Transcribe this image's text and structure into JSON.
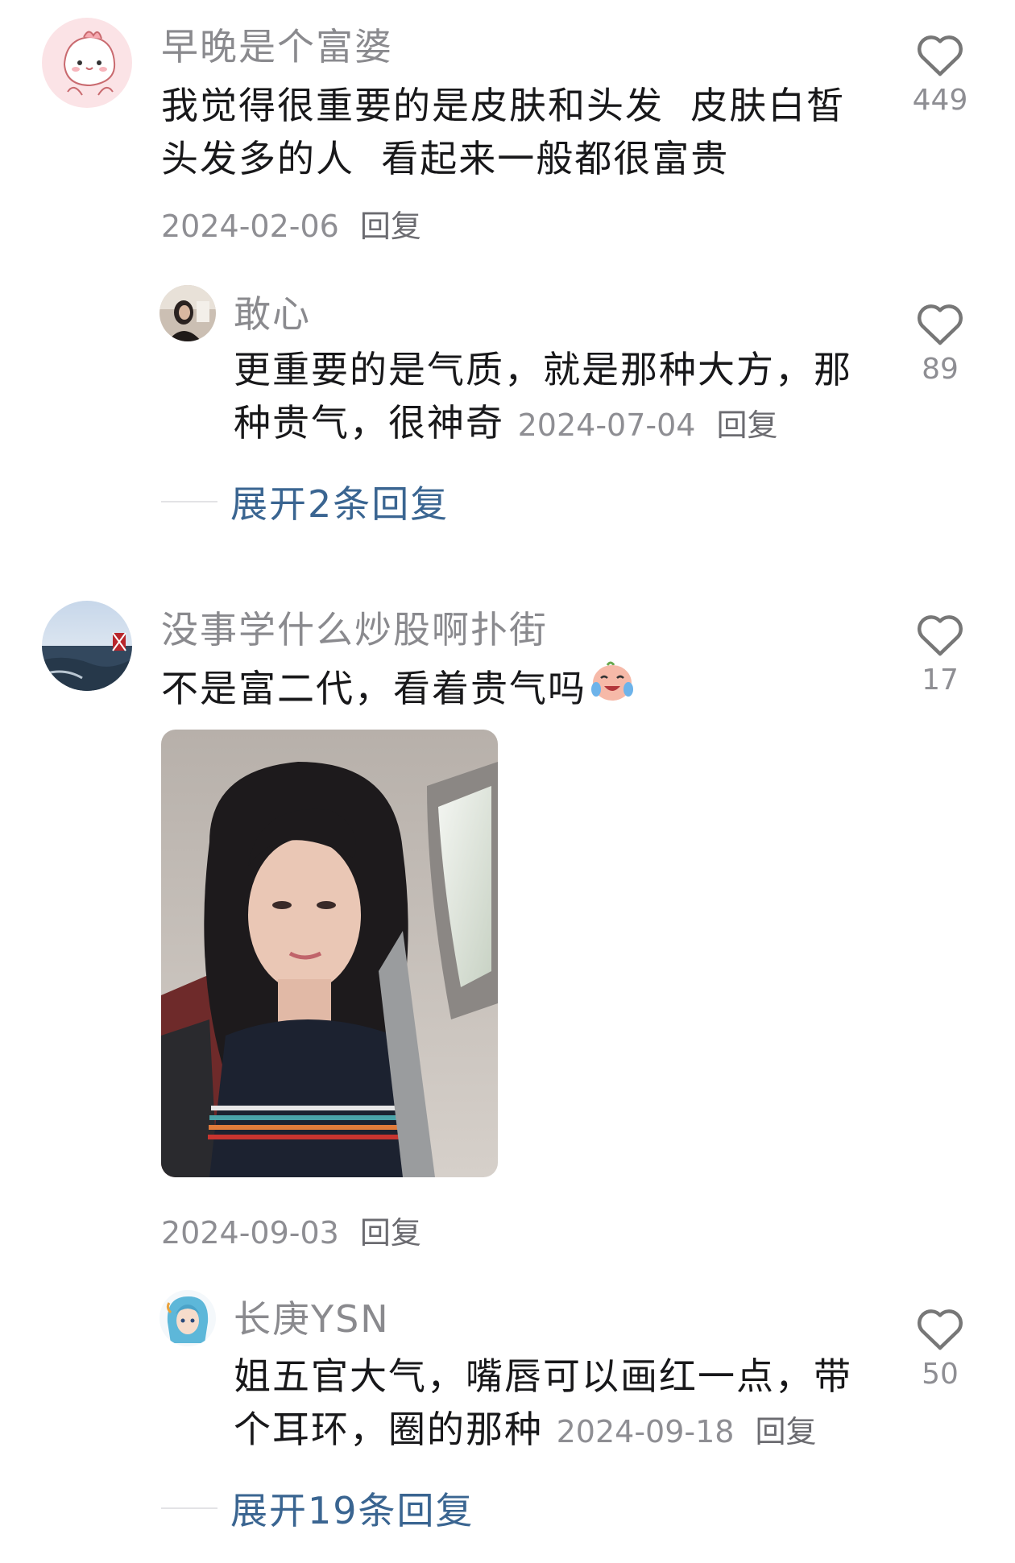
{
  "comments": [
    {
      "username": "早晚是个富婆",
      "text_line1": "我觉得很重要的是皮肤和头发  皮肤白皙",
      "text_line2": "头发多的人  看起来一般都很富贵",
      "date": "2024-02-06",
      "reply_label": "回复",
      "likes": "449",
      "avatar_icon": "pink-cartoon-avatar-icon",
      "replies": [
        {
          "username": "敢心",
          "text_line1": "更重要的是气质，就是那种大方，那",
          "text_line2": "种贵气，很神奇",
          "date": "2024-07-04",
          "reply_label": "回复",
          "likes": "89"
        }
      ],
      "expand_label": "展开2条回复"
    },
    {
      "username": "没事学什么炒股啊扑街",
      "text": "不是富二代，看着贵气吗",
      "emoji": "crying-laughing-emoji",
      "date": "2024-09-03",
      "reply_label": "回复",
      "likes": "17",
      "replies": [
        {
          "username": "长庚YSN",
          "text_line1": "姐五官大气，嘴唇可以画红一点，带",
          "text_line2": "个耳环，圈的那种",
          "date": "2024-09-18",
          "reply_label": "回复",
          "likes": "50"
        }
      ],
      "expand_label": "展开19条回复"
    }
  ],
  "colors": {
    "username": "#8a8a8e",
    "text": "#18181a",
    "meta": "#8e8e93",
    "expand": "#3a6591"
  }
}
